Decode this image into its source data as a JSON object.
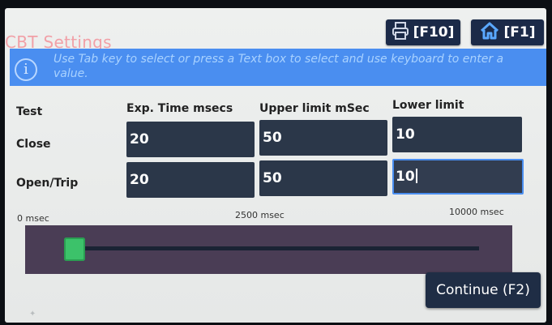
{
  "window": {
    "title": "CBT Settings"
  },
  "toolbar": {
    "print_label": "[F10]",
    "home_label": "[F1]",
    "print_icon": "printer-icon",
    "home_icon": "home-icon"
  },
  "info": {
    "icon": "info-icon",
    "text": "Use Tab key to select or press a Text box to select and use keyboard to enter a value."
  },
  "table": {
    "headers": [
      "Test",
      "Exp. Time msecs",
      "Upper limit mSec",
      "Lower limit"
    ],
    "rows": [
      {
        "label": "Close",
        "exp_time": "20",
        "upper": "50",
        "lower": "10"
      },
      {
        "label": "Open/Trip",
        "exp_time": "20",
        "upper": "50",
        "lower": "10"
      }
    ]
  },
  "slider": {
    "min_label": "0 msec",
    "mid_label": "2500 msec",
    "max_label": "10000 msec",
    "value_fraction": 0.0
  },
  "actions": {
    "continue_label": "Continue (F2)"
  },
  "colors": {
    "accent": "#4a8ef0",
    "field_bg": "#2b3749",
    "slider_thumb": "#3cc26a",
    "title": "#f1a0a7"
  }
}
